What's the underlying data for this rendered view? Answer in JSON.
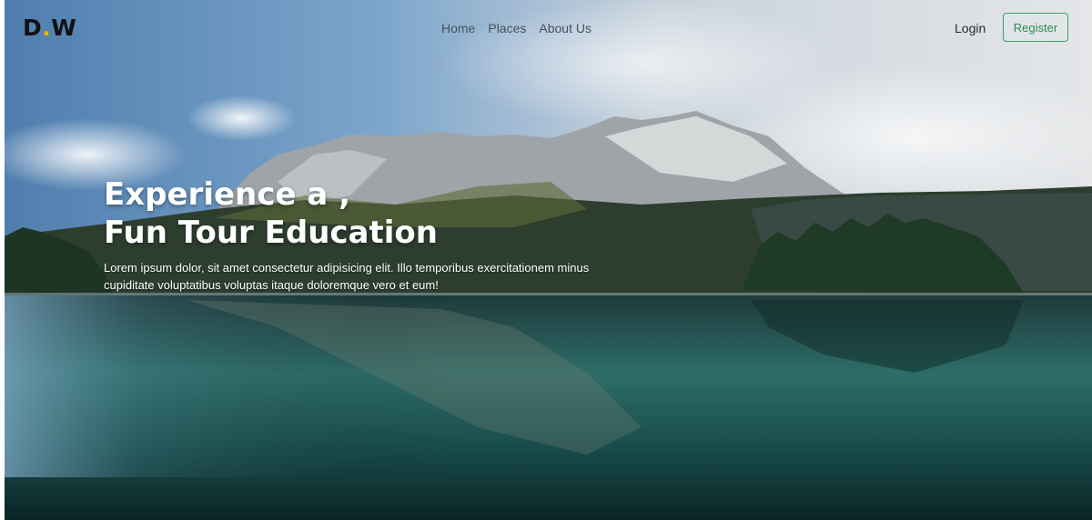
{
  "brand": {
    "left": "D",
    "dot": ".",
    "right": "W"
  },
  "nav": {
    "items": [
      "Home",
      "Places",
      "About Us"
    ]
  },
  "auth": {
    "login_label": "Login",
    "register_label": "Register"
  },
  "hero": {
    "title_line1": "Experience a ,",
    "title_line2": "Fun Tour Education",
    "description_line1": "Lorem ipsum dolor, sit amet consectetur adipisicing elit. Illo temporibus exercitationem minus",
    "description_line2": "cupiditate voluptatibus voluptas itaque doloremque vero et eum!"
  },
  "colors": {
    "accent": "#3f9e6a",
    "logo_dot": "#e8b400"
  }
}
